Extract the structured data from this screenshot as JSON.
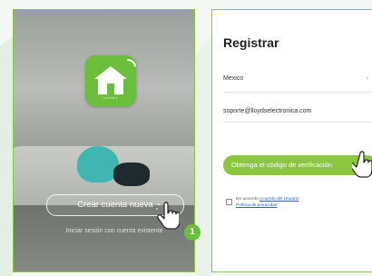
{
  "left_screen": {
    "app_brand": "LLOYD'S",
    "create_account_label": "Crear cuenta nueva",
    "login_link_label": "Iniciar sesión con cuenta existente"
  },
  "step_badge": "1",
  "right_screen": {
    "title": "Registrar",
    "country": "Mexico",
    "email": "soporte@lloydselectronica.com",
    "get_code_label": "Obtenga el código de verificación",
    "agree_prefix": "De acuerdo",
    "user_agreement_link": "Acuerdo del Usuario",
    "privacy_policy_link": "Política de privacidad"
  },
  "colors": {
    "accent_green": "#8cc63f",
    "app_icon_green": "#6cbf3b"
  }
}
